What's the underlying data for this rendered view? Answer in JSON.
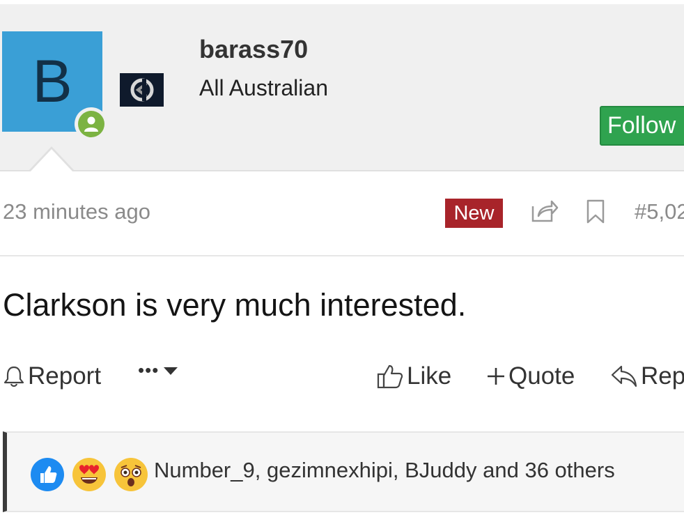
{
  "user": {
    "avatar_letter": "B",
    "username": "barass70",
    "title": "All Australian",
    "follow_label": "Follow"
  },
  "post": {
    "time": "23 minutes ago",
    "new_badge": "New",
    "number": "#5,02",
    "message": "Clarkson is very much interested."
  },
  "actions": {
    "report": "Report",
    "more": "•••",
    "like": "Like",
    "quote": "Quote",
    "reply": "Rep"
  },
  "reactions": {
    "icons": [
      "like-reaction-icon",
      "heart-eyes-reaction-icon",
      "wow-reaction-icon"
    ],
    "summary": "Number_9, gezimnexhipi, BJuddy and 36 others"
  },
  "colors": {
    "avatar_bg": "#3a9fd6",
    "follow_bg": "#2fa34f",
    "new_badge_bg": "#a8242a",
    "online_dot": "#7cb342"
  }
}
